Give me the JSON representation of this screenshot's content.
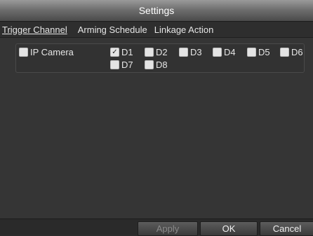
{
  "window": {
    "title": "Settings"
  },
  "tabs": [
    {
      "label": "Trigger Channel",
      "active": true
    },
    {
      "label": "Arming Schedule",
      "active": false
    },
    {
      "label": "Linkage Action",
      "active": false
    }
  ],
  "channels": {
    "ip_camera": {
      "label": "IP Camera",
      "checked": false
    },
    "items": [
      {
        "label": "D1",
        "checked": true
      },
      {
        "label": "D2",
        "checked": false
      },
      {
        "label": "D3",
        "checked": false
      },
      {
        "label": "D4",
        "checked": false
      },
      {
        "label": "D5",
        "checked": false
      },
      {
        "label": "D6",
        "checked": false
      },
      {
        "label": "D7",
        "checked": false
      },
      {
        "label": "D8",
        "checked": false
      }
    ]
  },
  "footer": {
    "apply_label": "Apply",
    "ok_label": "OK",
    "cancel_label": "Cancel",
    "apply_enabled": false
  },
  "colors": {
    "title_bar": "#6f6f6f",
    "background": "#353535",
    "checkbox": "#e4e4e4"
  }
}
